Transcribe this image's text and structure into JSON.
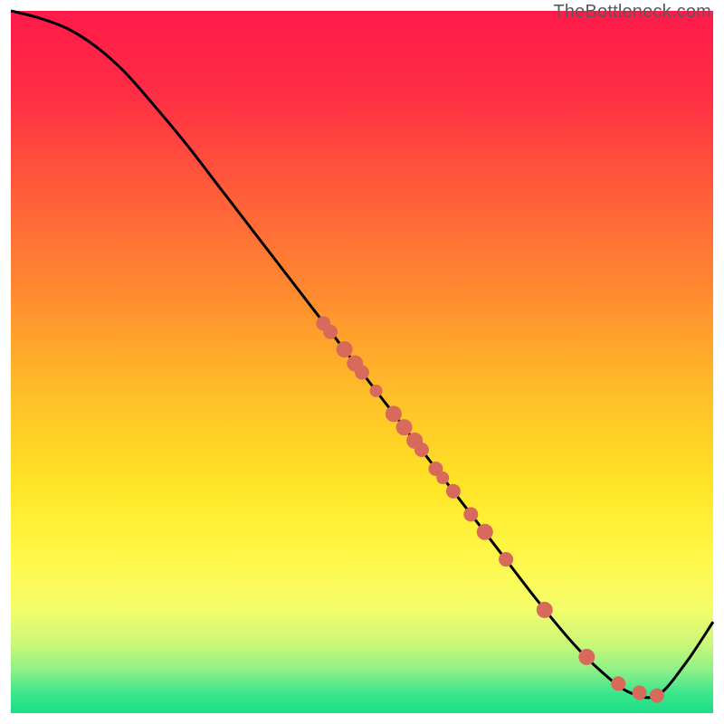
{
  "attribution": "TheBottleneck.com",
  "chart_data": {
    "type": "line",
    "title": "",
    "xlabel": "",
    "ylabel": "",
    "xlim": [
      0,
      100
    ],
    "ylim": [
      0,
      100
    ],
    "gradient": {
      "type": "vertical",
      "stops": [
        {
          "offset": 0.0,
          "color": "#ff1a4a"
        },
        {
          "offset": 0.12,
          "color": "#ff2e44"
        },
        {
          "offset": 0.25,
          "color": "#ff5a3a"
        },
        {
          "offset": 0.4,
          "color": "#ff8a30"
        },
        {
          "offset": 0.55,
          "color": "#ffc028"
        },
        {
          "offset": 0.68,
          "color": "#ffe626"
        },
        {
          "offset": 0.78,
          "color": "#fff84a"
        },
        {
          "offset": 0.85,
          "color": "#f5fd6a"
        },
        {
          "offset": 0.9,
          "color": "#ccf878"
        },
        {
          "offset": 0.94,
          "color": "#8bf088"
        },
        {
          "offset": 0.97,
          "color": "#3fe68c"
        },
        {
          "offset": 1.0,
          "color": "#19df86"
        }
      ]
    },
    "series": [
      {
        "name": "bottleneck-curve",
        "color": "#000000",
        "x": [
          0,
          4,
          8,
          12,
          16,
          20,
          25,
          30,
          35,
          40,
          45,
          50,
          55,
          60,
          65,
          70,
          75,
          80,
          84,
          88,
          92,
          96,
          100
        ],
        "y": [
          100,
          99,
          97.5,
          95,
          91.5,
          87,
          81,
          74.5,
          68,
          61.5,
          55,
          48.5,
          42,
          35.5,
          29,
          22.5,
          16,
          10,
          6,
          3,
          2.5,
          7,
          13
        ]
      }
    ],
    "marker_points": {
      "name": "highlighted-samples",
      "color": "#d86a5c",
      "radius_variants": [
        7,
        8,
        9,
        10
      ],
      "points": [
        {
          "x": 44.5,
          "y": 55.5,
          "r": 8
        },
        {
          "x": 45.5,
          "y": 54.3,
          "r": 8
        },
        {
          "x": 47.5,
          "y": 51.8,
          "r": 9
        },
        {
          "x": 49.0,
          "y": 49.8,
          "r": 9
        },
        {
          "x": 50.0,
          "y": 48.5,
          "r": 8
        },
        {
          "x": 52.0,
          "y": 45.9,
          "r": 7
        },
        {
          "x": 54.5,
          "y": 42.6,
          "r": 9
        },
        {
          "x": 56.0,
          "y": 40.7,
          "r": 9
        },
        {
          "x": 57.5,
          "y": 38.8,
          "r": 9
        },
        {
          "x": 58.5,
          "y": 37.5,
          "r": 8
        },
        {
          "x": 60.5,
          "y": 34.8,
          "r": 8
        },
        {
          "x": 61.5,
          "y": 33.5,
          "r": 7
        },
        {
          "x": 63.0,
          "y": 31.6,
          "r": 8
        },
        {
          "x": 65.5,
          "y": 28.3,
          "r": 8
        },
        {
          "x": 67.5,
          "y": 25.8,
          "r": 9
        },
        {
          "x": 70.5,
          "y": 21.9,
          "r": 8
        },
        {
          "x": 76.0,
          "y": 14.7,
          "r": 9
        },
        {
          "x": 82.0,
          "y": 8.0,
          "r": 9
        },
        {
          "x": 86.5,
          "y": 4.2,
          "r": 8
        },
        {
          "x": 89.5,
          "y": 2.9,
          "r": 8
        },
        {
          "x": 92.0,
          "y": 2.5,
          "r": 8
        }
      ]
    }
  }
}
